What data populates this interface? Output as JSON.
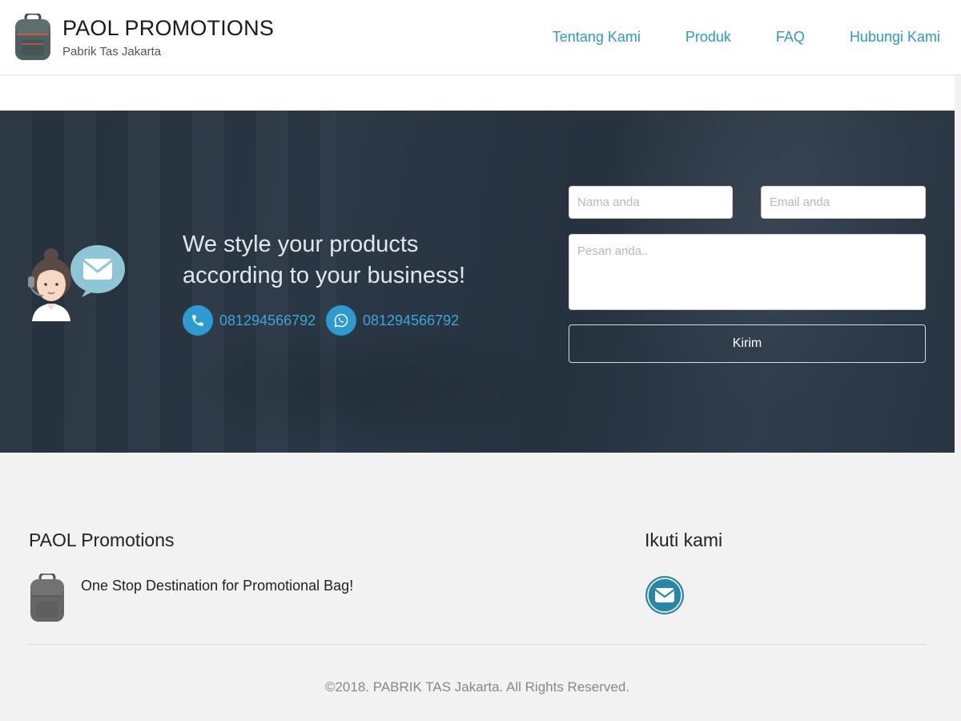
{
  "header": {
    "brand_title": "PAOL PROMOTIONS",
    "brand_subtitle": "Pabrik Tas Jakarta",
    "logo_icon": "backpack-icon",
    "nav": [
      {
        "label": "Tentang Kami"
      },
      {
        "label": "Produk"
      },
      {
        "label": "FAQ"
      },
      {
        "label": "Hubungi Kami"
      }
    ]
  },
  "hero": {
    "illustration": "support-agent-mail-icon",
    "tagline_line1": "We style your products",
    "tagline_line2": "according to your business!",
    "phone": {
      "icon": "phone-icon",
      "number": "081294566792"
    },
    "whatsapp": {
      "icon": "whatsapp-icon",
      "number": "081294566792"
    },
    "form": {
      "name_placeholder": "Nama anda",
      "email_placeholder": "Email anda",
      "message_placeholder": "Pesan anda..",
      "submit_label": "Kirim"
    }
  },
  "footer": {
    "company_title": "PAOL Promotions",
    "company_icon": "backpack-icon",
    "company_desc": "One Stop Destination for Promotional Bag!",
    "follow_title": "Ikuti kami",
    "follow_icon": "envelope-icon",
    "copyright": "©2018. PABRIK TAS Jakarta. All Rights Reserved."
  },
  "colors": {
    "accent": "#2e9bbf",
    "hero_bg": "#2a3643",
    "footer_bg": "#f2f2f2"
  }
}
